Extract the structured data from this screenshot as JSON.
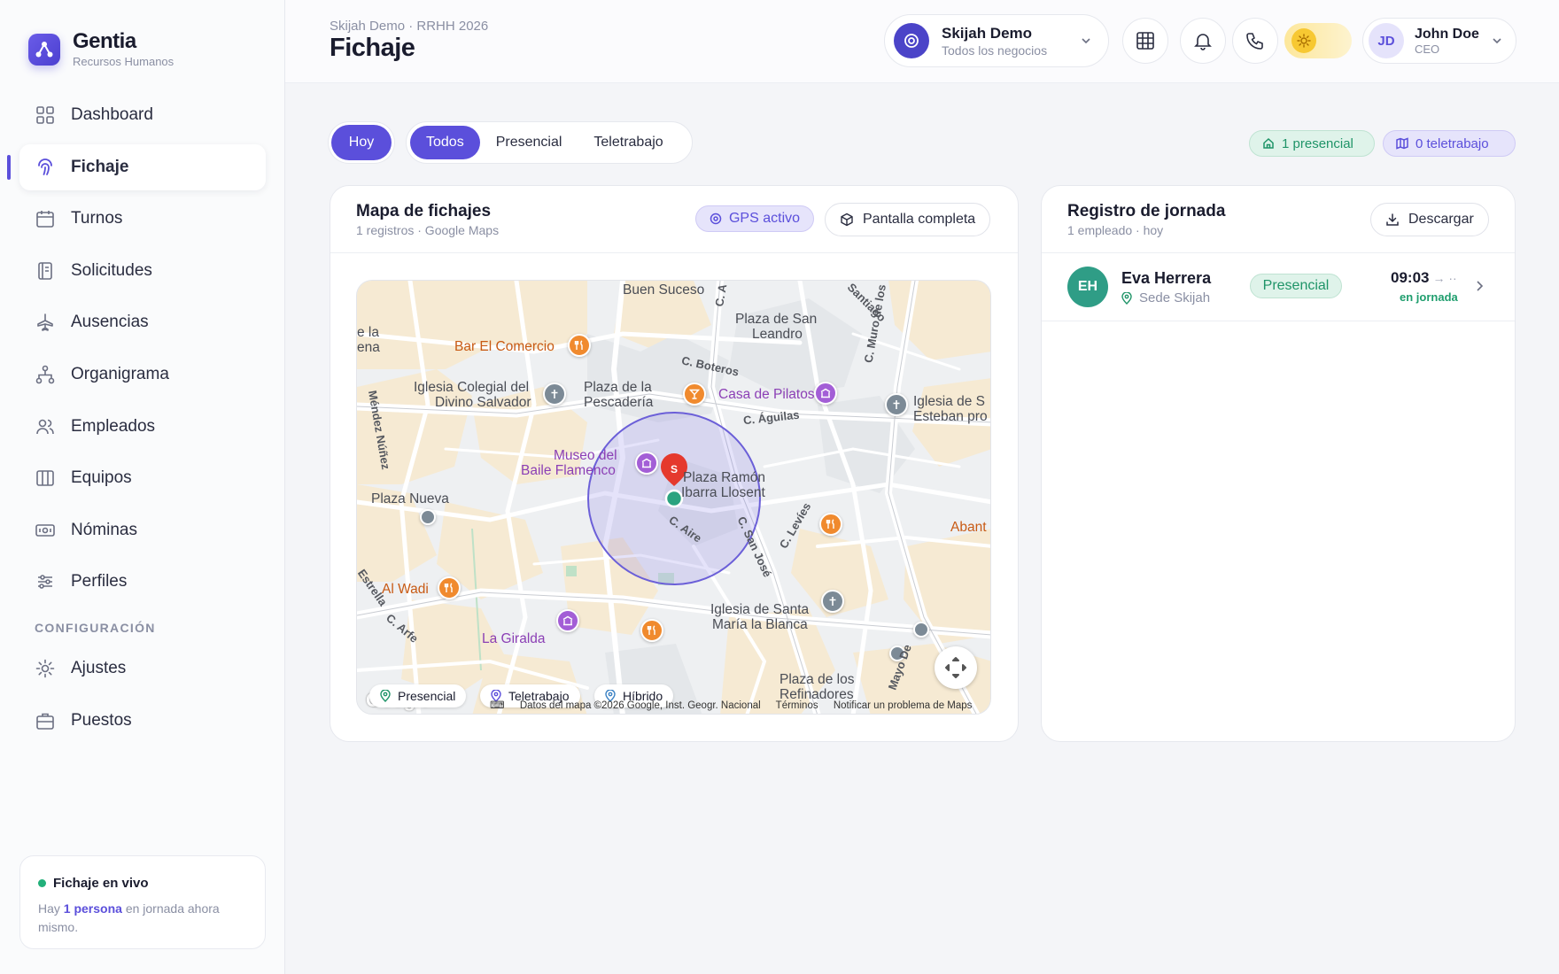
{
  "brand": {
    "name": "Gentia",
    "subtitle": "Recursos Humanos"
  },
  "nav": {
    "items": [
      {
        "label": "Dashboard",
        "icon": "grid-icon"
      },
      {
        "label": "Fichaje",
        "icon": "fingerprint-icon",
        "active": true
      },
      {
        "label": "Turnos",
        "icon": "calendar-icon"
      },
      {
        "label": "Solicitudes",
        "icon": "document-icon"
      },
      {
        "label": "Ausencias",
        "icon": "plane-icon"
      },
      {
        "label": "Organigrama",
        "icon": "org-chart-icon"
      },
      {
        "label": "Empleados",
        "icon": "users-icon"
      },
      {
        "label": "Equipos",
        "icon": "columns-icon"
      },
      {
        "label": "Nóminas",
        "icon": "banknote-icon"
      },
      {
        "label": "Perfiles",
        "icon": "sliders-icon"
      }
    ],
    "config_title": "CONFIGURACIÓN",
    "config_items": [
      {
        "label": "Ajustes",
        "icon": "gear-icon"
      },
      {
        "label": "Puestos",
        "icon": "briefcase-icon"
      }
    ]
  },
  "live": {
    "title": "Fichaje en vivo",
    "text_pre": "Hay",
    "count": "1 persona",
    "text_post": "en jornada ahora mismo."
  },
  "header": {
    "breadcrumb": "Skijah Demo · RRHH 2026",
    "title": "Fichaje",
    "business": {
      "name": "Skijah Demo",
      "subtitle": "Todos los negocios"
    },
    "user": {
      "initials": "JD",
      "name": "John Doe",
      "role": "CEO"
    }
  },
  "filters": {
    "today": "Hoy",
    "options": [
      "Todos",
      "Presencial",
      "Teletrabajo"
    ],
    "selected": "Todos",
    "badge_presencial": "1 presencial",
    "badge_teletrabajo": "0 teletrabajo"
  },
  "map_card": {
    "title": "Mapa de fichajes",
    "subtitle": "1 registros · Google Maps",
    "gps": "GPS activo",
    "fullscreen": "Pantalla completa",
    "legend": [
      "Presencial",
      "Teletrabajo",
      "Híbrido"
    ],
    "attribution": [
      "Datos del mapa ©2026 Google, Inst. Geogr. Nacional",
      "Términos",
      "Notificar un problema de Maps"
    ],
    "watermark": "Google",
    "marker_letter": "S",
    "labels": {
      "buen_suceso": "Buen Suceso",
      "bar_comercio": "Bar El Comercio",
      "iglesia_colegial_1": "Iglesia Colegial del",
      "iglesia_colegial_2": "Divino Salvador",
      "plaza_pescaderia_1": "Plaza de la",
      "plaza_pescaderia_2": "Pescadería",
      "c_boteros": "C. Boteros",
      "casa_pilatos": "Casa de Pilatos",
      "plaza_leandro_1": "Plaza de San",
      "plaza_leandro_2": "Leandro",
      "santiago": "Santiago",
      "c_aguilas": "C. Águilas",
      "iglesia_esteban_1": "Iglesia de S",
      "iglesia_esteban_2": "Esteban pro",
      "museo_1": "Museo del",
      "museo_2": "Baile Flamenco",
      "plaza_ramon_1": "Plaza Ramón",
      "plaza_ramon_2": "Ibarra Llosent",
      "plaza_nueva": "Plaza Nueva",
      "c_aire": "C. Aire",
      "c_levies": "C. Levíes",
      "c_san_jose": "C. San José",
      "abant": "Abant",
      "al_wadi": "Al Wadi",
      "la_giralda": "La Giralda",
      "iglesia_santa_1": "Iglesia de Santa",
      "iglesia_santa_2": "María la Blanca",
      "plaza_refinadores_1": "Plaza de los",
      "plaza_refinadores_2": "Refinadores",
      "e_la": "e la",
      "ena": "ena",
      "mendez_nunez": "Méndez Núñez",
      "c_muro": "C. Muro de los",
      "c_a": "C. A",
      "estrella": "Estrella",
      "c_arfe": "C. Arfe",
      "mayo_de": "Mayo De"
    }
  },
  "registro": {
    "title": "Registro de jornada",
    "subtitle": "1 empleado · hoy",
    "download": "Descargar",
    "rows": [
      {
        "initials": "EH",
        "name": "Eva Herrera",
        "location": "Sede Skijah",
        "mode": "Presencial",
        "time_in": "09:03",
        "time_out": "→ ·· ",
        "status": "en jornada"
      }
    ]
  },
  "colors": {
    "accent": "#5b4fdb",
    "success": "#1f9468",
    "avatar_green": "#2f9d86"
  }
}
